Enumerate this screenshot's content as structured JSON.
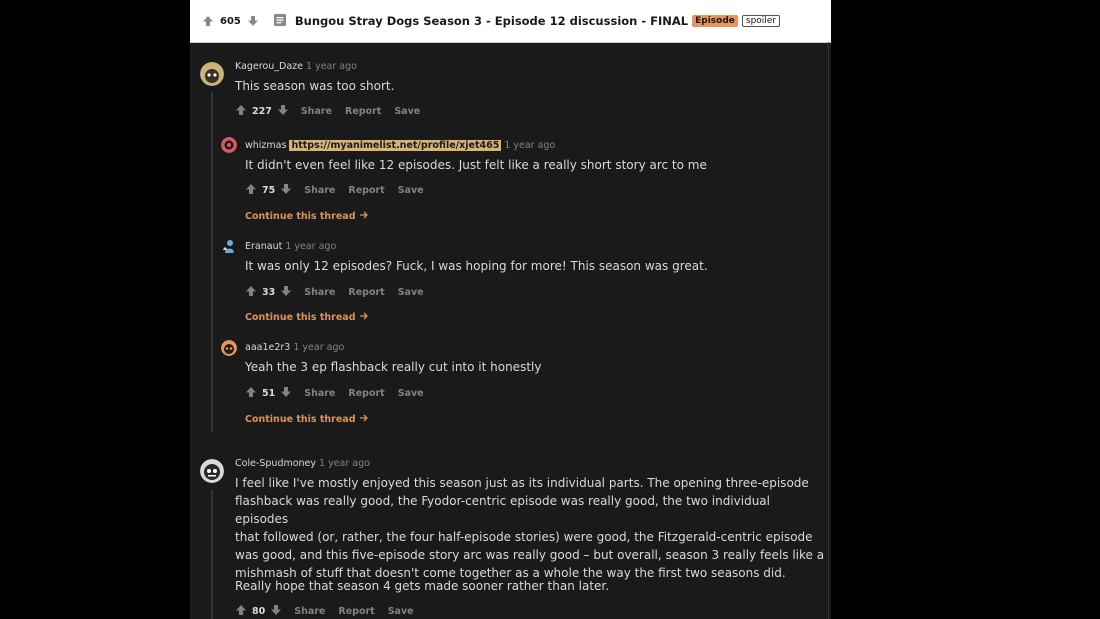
{
  "post": {
    "score": "605",
    "title": "Bungou Stray Dogs Season 3 - Episode 12 discussion - FINAL",
    "flair": "Episode",
    "spoiler": "spoiler"
  },
  "colors": {
    "upvote": "#818384",
    "flair_episode": "#e8955b",
    "user_flair": "#d7b374",
    "link": "#d7955b"
  },
  "comments": [
    {
      "author": "Kagerou_Daze",
      "time": "1 year ago",
      "body": "This season was too short.",
      "score": "227",
      "share": "Share",
      "report": "Report",
      "save": "Save"
    },
    {
      "author": "whizmas",
      "flair": "https://myanimelist.net/profile/xjet465",
      "time": "1 year ago",
      "body": "It didn't even feel like 12 episodes. Just felt like a really short story arc to me",
      "score": "75",
      "share": "Share",
      "report": "Report",
      "save": "Save",
      "continue": "Continue this thread"
    },
    {
      "author": "Eranaut",
      "time": "1 year ago",
      "body": "It was only 12 episodes? Fuck, I was hoping for more! This season was great.",
      "score": "33",
      "share": "Share",
      "report": "Report",
      "save": "Save",
      "continue": "Continue this thread"
    },
    {
      "author": "aaa1e2r3",
      "time": "1 year ago",
      "body": "Yeah the 3 ep flashback really cut into it honestly",
      "score": "51",
      "share": "Share",
      "report": "Report",
      "save": "Save",
      "continue": "Continue this thread"
    },
    {
      "author": "Cole-Spudmoney",
      "time": "1 year ago",
      "body_lines": [
        "I feel like I've mostly enjoyed this season just as its individual parts. The opening three-episode",
        "flashback was really good, the Fyodor-centric episode was really good, the two individual episodes",
        "that followed (or, rather, the four half-episode stories) were good, the Fitzgerald-centric episode",
        "was good, and this five-episode story arc was really good – but overall, season 3 really feels like a",
        "mishmash of stuff that doesn't come together as a whole the way the first two seasons did."
      ],
      "body2": "Really hope that season 4 gets made sooner rather than later.",
      "score": "80",
      "share": "Share",
      "report": "Report",
      "save": "Save"
    }
  ]
}
